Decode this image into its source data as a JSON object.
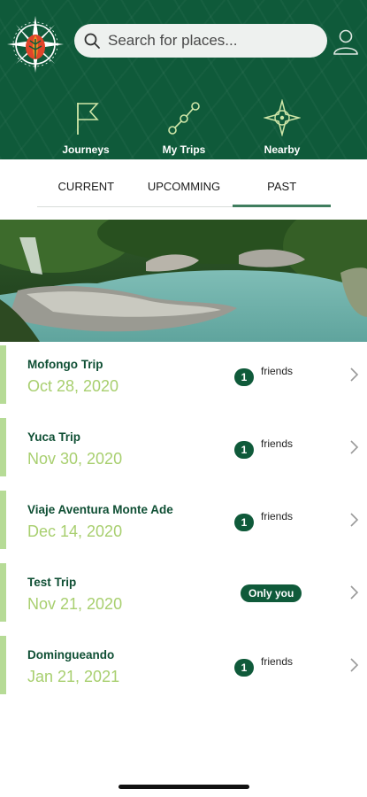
{
  "search": {
    "placeholder": "Search for places..."
  },
  "nav": [
    {
      "label": "Journeys",
      "icon": "flag-icon"
    },
    {
      "label": "My Trips",
      "icon": "route-icon"
    },
    {
      "label": "Nearby",
      "icon": "compass-icon"
    }
  ],
  "tabs": [
    {
      "label": "CURRENT",
      "active": false
    },
    {
      "label": "UPCOMMING",
      "active": false
    },
    {
      "label": "PAST",
      "active": true
    }
  ],
  "trips": [
    {
      "name": "Mofongo Trip",
      "date": "Oct 28, 2020",
      "friends_count": "1",
      "friends_label": "friends"
    },
    {
      "name": "Yuca Trip",
      "date": "Nov 30, 2020",
      "friends_count": "1",
      "friends_label": "friends"
    },
    {
      "name": "Viaje Aventura Monte Ade",
      "date": "Dec 14, 2020",
      "friends_count": "1",
      "friends_label": "friends"
    },
    {
      "name": "Test Trip",
      "date": "Nov 21, 2020",
      "only_you": "Only you"
    },
    {
      "name": "Domingueando",
      "date": "Jan 21, 2021",
      "friends_count": "1",
      "friends_label": "friends"
    }
  ],
  "colors": {
    "brand_green": "#0f5a3a",
    "accent_lime": "#a8cf6f",
    "trip_bar": "#b6db96",
    "logo_red": "#e0452a",
    "logo_orange": "#f08a24"
  }
}
